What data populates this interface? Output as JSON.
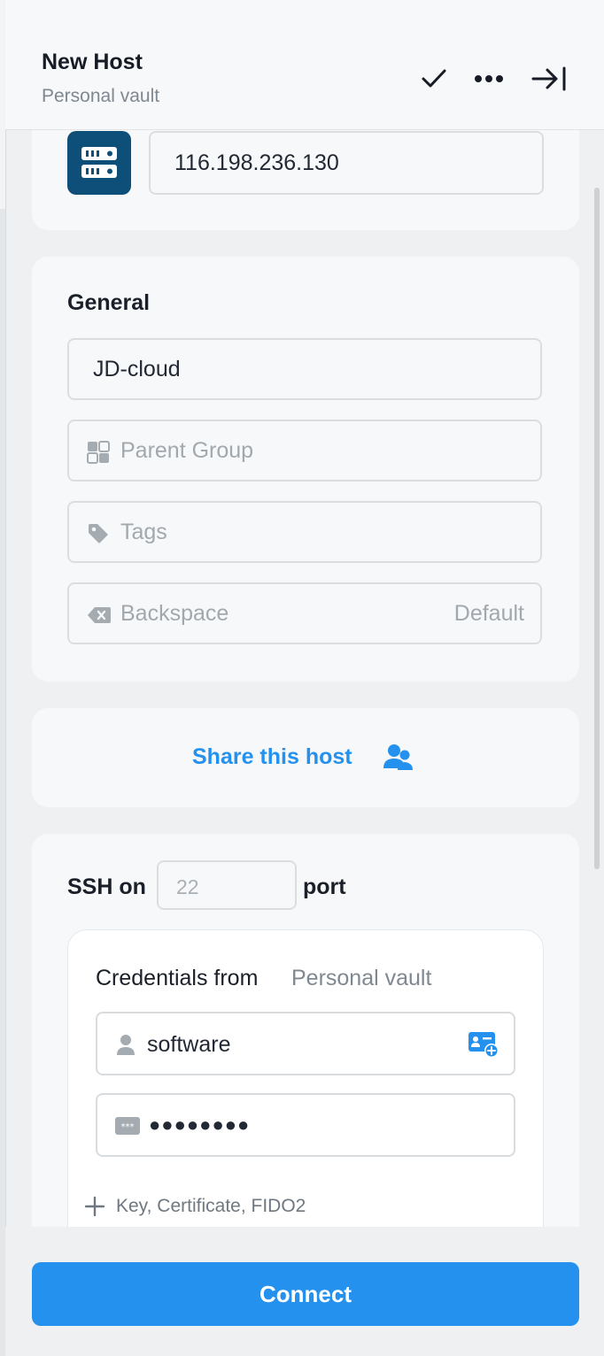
{
  "header": {
    "title": "New Host",
    "subtitle": "Personal vault",
    "icons": [
      "checkmark-icon",
      "more-icon",
      "collapse-panel-icon"
    ]
  },
  "address": {
    "value": "116.198.236.130",
    "icon": "server-icon"
  },
  "general": {
    "title": "General",
    "label_value": "JD-cloud",
    "parent_group_placeholder": "Parent Group",
    "tags_placeholder": "Tags",
    "backspace_label": "Backspace",
    "backspace_value": "Default"
  },
  "share": {
    "label": "Share this host",
    "icon": "users-icon"
  },
  "ssh": {
    "prefix": "SSH on",
    "port_placeholder": "22",
    "suffix": "port",
    "credentials_label": "Credentials from",
    "credentials_source": "Personal vault",
    "username": "software",
    "password_masked": "●●●●●●●●",
    "add_key_label": "Key, Certificate, FIDO2"
  },
  "connect_label": "Connect",
  "colors": {
    "accent": "#2491ee",
    "server_tile": "#0d4f79"
  }
}
